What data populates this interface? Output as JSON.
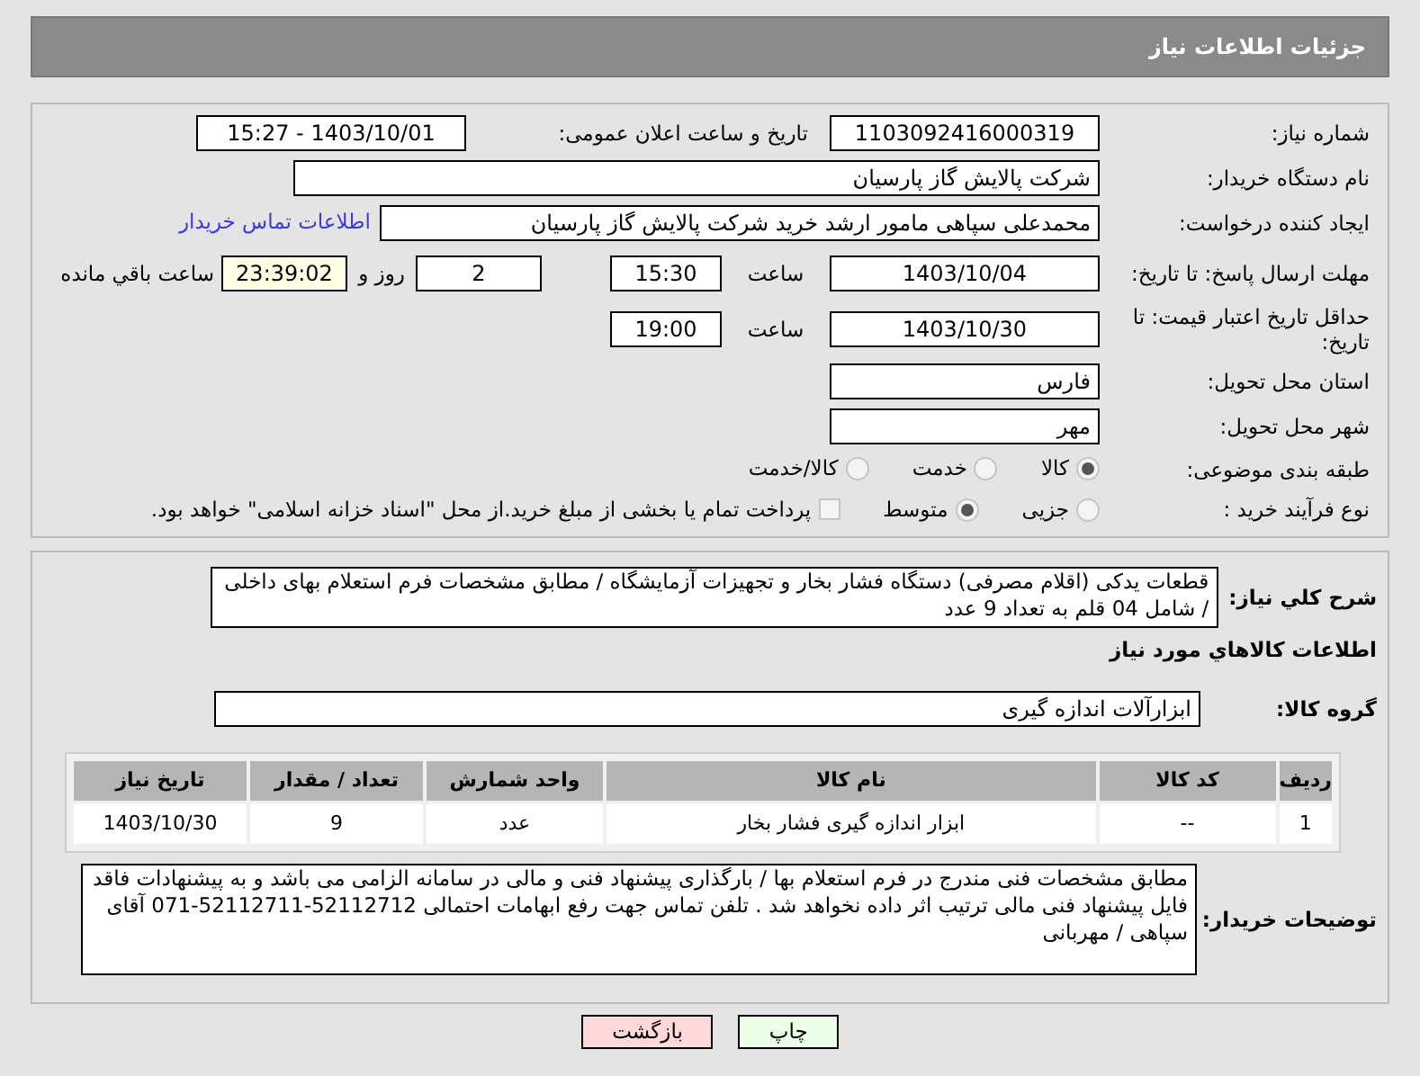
{
  "header": {
    "title": "جزئیات اطلاعات نیاز"
  },
  "need_number": {
    "label": "شماره نیاز:",
    "value": "1103092416000319"
  },
  "announce": {
    "label": "تاریخ و ساعت اعلان عمومی:",
    "value": "1403/10/01 - 15:27"
  },
  "buyer": {
    "label": "نام دستگاه خریدار:",
    "value": "شرکت پالایش گاز پارسیان"
  },
  "creator": {
    "label": "ایجاد کننده درخواست:",
    "value": "محمدعلی سپاهی مامور ارشد خرید شرکت پالایش گاز پارسیان",
    "link": "اطلاعات تماس خریدار"
  },
  "deadline": {
    "label": "مهلت ارسال پاسخ: تا تاریخ:",
    "date": "1403/10/04",
    "time_label": "ساعت",
    "time": "15:30",
    "days": "2",
    "days_label": "روز و",
    "remaining": "23:39:02",
    "remaining_label": "ساعت باقي مانده"
  },
  "validity": {
    "label": "حداقل تاریخ اعتبار قیمت: تا تاریخ:",
    "date": "1403/10/30",
    "time_label": "ساعت",
    "time": "19:00"
  },
  "province": {
    "label": "استان محل تحویل:",
    "value": "فارس"
  },
  "city": {
    "label": "شهر محل تحویل:",
    "value": "مهر"
  },
  "category": {
    "label": "طبقه بندی موضوعی:",
    "options": [
      {
        "label": "کالا",
        "selected": true
      },
      {
        "label": "خدمت",
        "selected": false
      },
      {
        "label": "کالا/خدمت",
        "selected": false
      }
    ]
  },
  "purchase_type": {
    "label": "نوع فرآیند خرید :",
    "options": [
      {
        "label": "جزیی",
        "selected": false
      },
      {
        "label": "متوسط",
        "selected": true
      }
    ],
    "treasury": {
      "label": "پرداخت تمام یا بخشی از مبلغ خرید.از محل \"اسناد خزانه اسلامی\" خواهد بود.",
      "checked": false
    }
  },
  "summary": {
    "label": "شرح کلي نیاز:",
    "value": "قطعات یدکی (اقلام مصرفی) دستگاه فشار بخار و تجهیزات آزمایشگاه / مطابق مشخصات فرم استعلام بهای داخلی / شامل 04 قلم به تعداد 9 عدد"
  },
  "goods_heading": "اطلاعات کالاهاي مورد نیاز",
  "goods_group": {
    "label": "گروه کالا:",
    "value": "ابزارآلات اندازه گیری"
  },
  "table": {
    "columns": [
      "ردیف",
      "کد کالا",
      "نام کالا",
      "واحد شمارش",
      "تعداد / مقدار",
      "تاریخ نیاز"
    ],
    "rows": [
      [
        "1",
        "--",
        "ابزار اندازه گیری فشار بخار",
        "عدد",
        "9",
        "1403/10/30"
      ]
    ]
  },
  "buyer_notes": {
    "label": "توضیحات خریدار:",
    "value": "مطابق مشخصات فنی مندرج در فرم استعلام بها / بارگذاری پیشنهاد فنی و مالی در سامانه الزامی می باشد و به پیشنهادات فاقد فایل پیشنهاد فنی مالی ترتیب اثر داده نخواهد شد . تلفن تماس جهت رفع ابهامات احتمالی 52112712-52112711-071 آقای سپاهی / مهربانی"
  },
  "buttons": [
    {
      "label": "چاپ",
      "kind": "print"
    },
    {
      "label": "بازگشت",
      "kind": "back"
    }
  ]
}
